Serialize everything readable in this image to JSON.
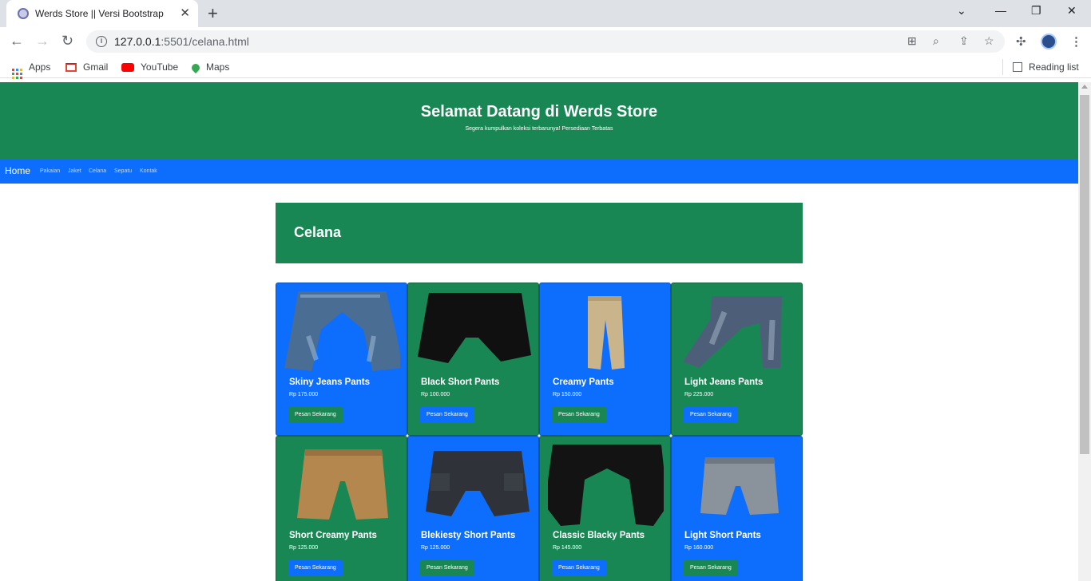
{
  "browser": {
    "tab_title": "Werds Store || Versi Bootstrap",
    "url_host": "127.0.0.1",
    "url_rest": ":5501/celana.html",
    "bookmarks": [
      "Apps",
      "Gmail",
      "YouTube",
      "Maps"
    ],
    "reading_list": "Reading list"
  },
  "header": {
    "title": "Selamat Datang di Werds Store",
    "subtitle": "Segera kumpulkan koleksi terbarunya! Persediaan Terbatas"
  },
  "nav": {
    "brand": "Home",
    "links": [
      "Pakaian",
      "Jaket",
      "Celana",
      "Sepatu",
      "Kontak"
    ]
  },
  "section": {
    "title": "Celana"
  },
  "products": [
    {
      "name": "Skiny Jeans Pants",
      "price": "Rp 175.000",
      "button": "Pesan Sekarang",
      "theme": "blue",
      "image": "jeans-pants"
    },
    {
      "name": "Black Short Pants",
      "price": "Rp 100.000",
      "button": "Pesan Sekarang",
      "theme": "green",
      "image": "black-shorts"
    },
    {
      "name": "Creamy Pants",
      "price": "Rp 150.000",
      "button": "Pesan Sekarang",
      "theme": "blue",
      "image": "cream-pants"
    },
    {
      "name": "Light Jeans Pants",
      "price": "Rp 225.000",
      "button": "Pesan Sekarang",
      "theme": "green",
      "image": "light-jeans"
    },
    {
      "name": "Short Creamy Pants",
      "price": "Rp 125.000",
      "button": "Pesan Sekarang",
      "theme": "green",
      "image": "khaki-shorts"
    },
    {
      "name": "Blekiesty Short Pants",
      "price": "Rp 125.000",
      "button": "Pesan Sekarang",
      "theme": "blue",
      "image": "cargo-shorts"
    },
    {
      "name": "Classic Blacky Pants",
      "price": "Rp 145.000",
      "button": "Pesan Sekarang",
      "theme": "green",
      "image": "black-pants"
    },
    {
      "name": "Light Short Pants",
      "price": "Rp 160.000",
      "button": "Pesan Sekarang",
      "theme": "blue",
      "image": "denim-shorts"
    }
  ],
  "colors": {
    "green": "#198754",
    "blue": "#0d6efd"
  }
}
